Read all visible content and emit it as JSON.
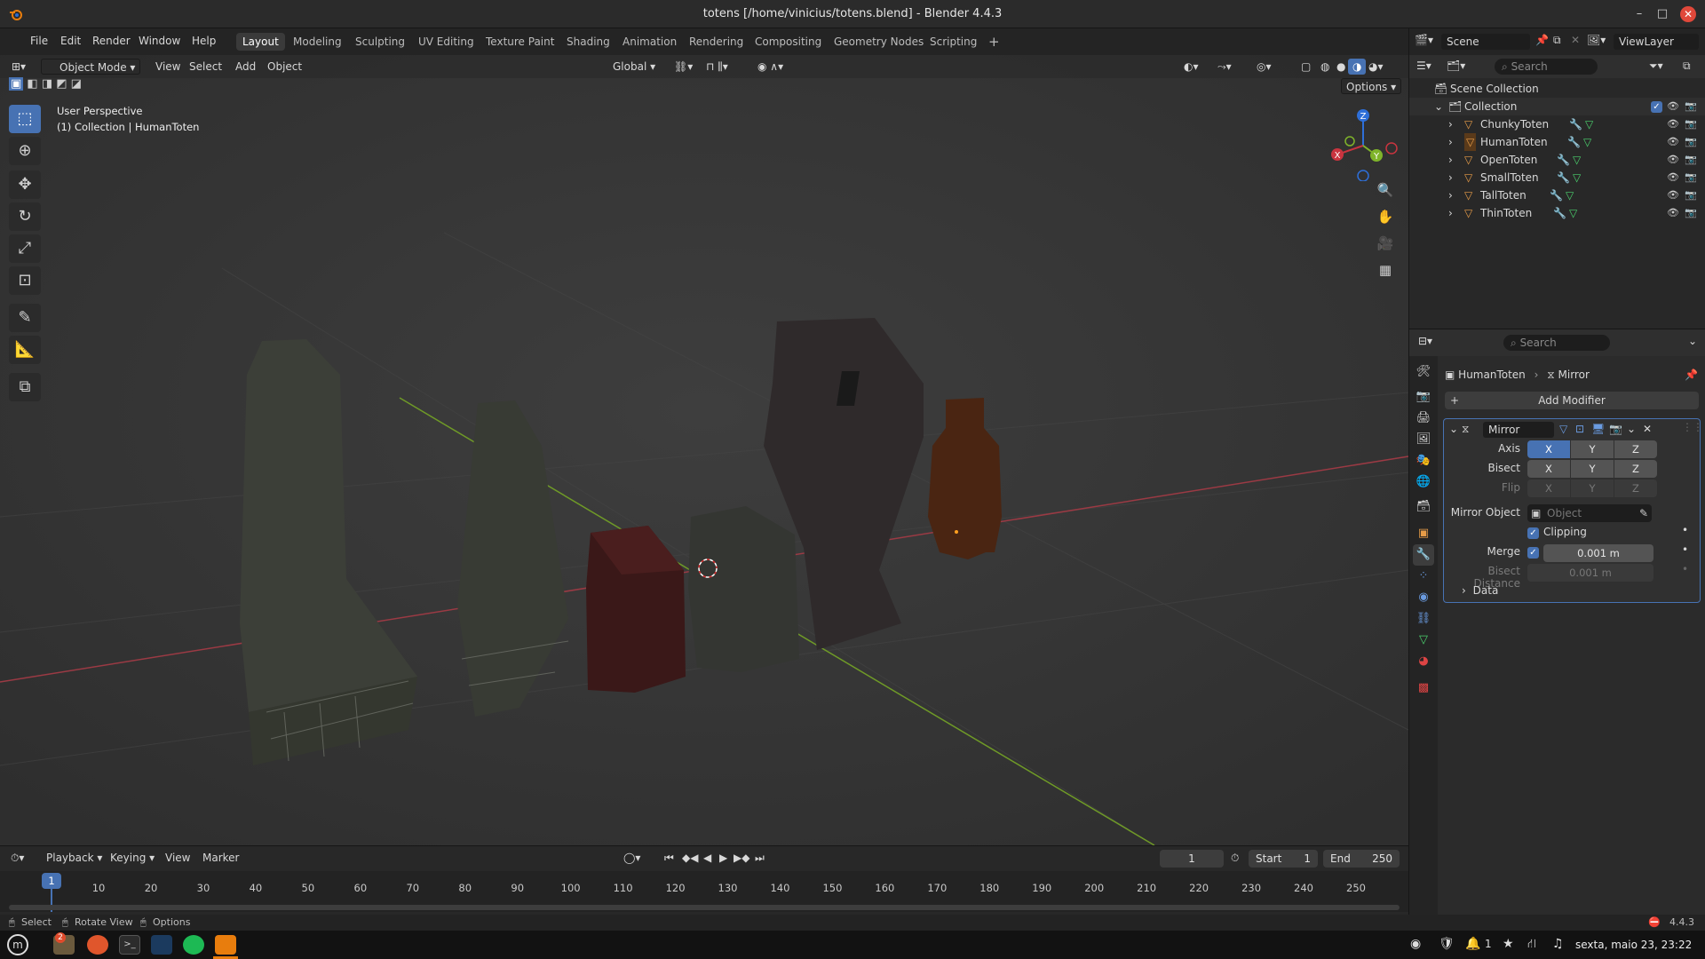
{
  "window": {
    "title": "totens [/home/vinicius/totens.blend] - Blender 4.4.3",
    "minimize": "–",
    "maximize": "□",
    "close": "✕"
  },
  "menu": [
    "File",
    "Edit",
    "Render",
    "Window",
    "Help"
  ],
  "workspaces": [
    "Layout",
    "Modeling",
    "Sculpting",
    "UV Editing",
    "Texture Paint",
    "Shading",
    "Animation",
    "Rendering",
    "Compositing",
    "Geometry Nodes",
    "Scripting"
  ],
  "workspace_add": "+",
  "scene": {
    "scene_name": "Scene",
    "view_layer": "ViewLayer"
  },
  "viewport": {
    "mode": "Object Mode",
    "menus": [
      "View",
      "Select",
      "Add",
      "Object"
    ],
    "orientation": "Global",
    "options": "Options",
    "overlay_text_1": "User Perspective",
    "overlay_text_2": "(1) Collection | HumanToten",
    "gizmo": {
      "x": "X",
      "y": "Y",
      "z": "Z"
    }
  },
  "outliner": {
    "search_placeholder": "Search",
    "scene_collection": "Scene Collection",
    "collection": "Collection",
    "objects": [
      "ChunkyToten",
      "HumanToten",
      "OpenToten",
      "SmallToten",
      "TallToten",
      "ThinToten"
    ]
  },
  "properties": {
    "search_placeholder": "Search",
    "breadcrumb_object": "HumanToten",
    "breadcrumb_modifier": "Mirror",
    "add_modifier": "Add Modifier",
    "modifier_name": "Mirror",
    "axis_label": "Axis",
    "bisect_label": "Bisect",
    "flip_label": "Flip",
    "axis_x": "X",
    "axis_y": "Y",
    "axis_z": "Z",
    "mirror_object_label": "Mirror Object",
    "mirror_object_placeholder": "Object",
    "clipping_label": "Clipping",
    "merge_label": "Merge",
    "merge_value": "0.001 m",
    "bisect_distance_label": "Bisect Distance",
    "bisect_distance_value": "0.001 m",
    "data_label": "Data"
  },
  "timeline": {
    "menus": [
      "Playback",
      "Keying",
      "View",
      "Marker"
    ],
    "current_frame": "1",
    "start_label": "Start",
    "start_value": "1",
    "end_label": "End",
    "end_value": "250",
    "ticks": [
      "1",
      "10",
      "20",
      "30",
      "40",
      "50",
      "60",
      "70",
      "80",
      "90",
      "100",
      "110",
      "120",
      "130",
      "140",
      "150",
      "160",
      "170",
      "180",
      "190",
      "200",
      "210",
      "220",
      "230",
      "240",
      "250"
    ]
  },
  "statusbar": {
    "select": "Select",
    "rotate_view": "Rotate View",
    "options": "Options",
    "version": "4.4.3"
  },
  "taskbar": {
    "badge": "2",
    "notifications": "1",
    "datetime": "sexta, maio 23, 23:22"
  },
  "colors": {
    "accent": "#4772b3",
    "viewport_bg": "#3a3a3a",
    "panel_bg": "#2b2b2b"
  }
}
